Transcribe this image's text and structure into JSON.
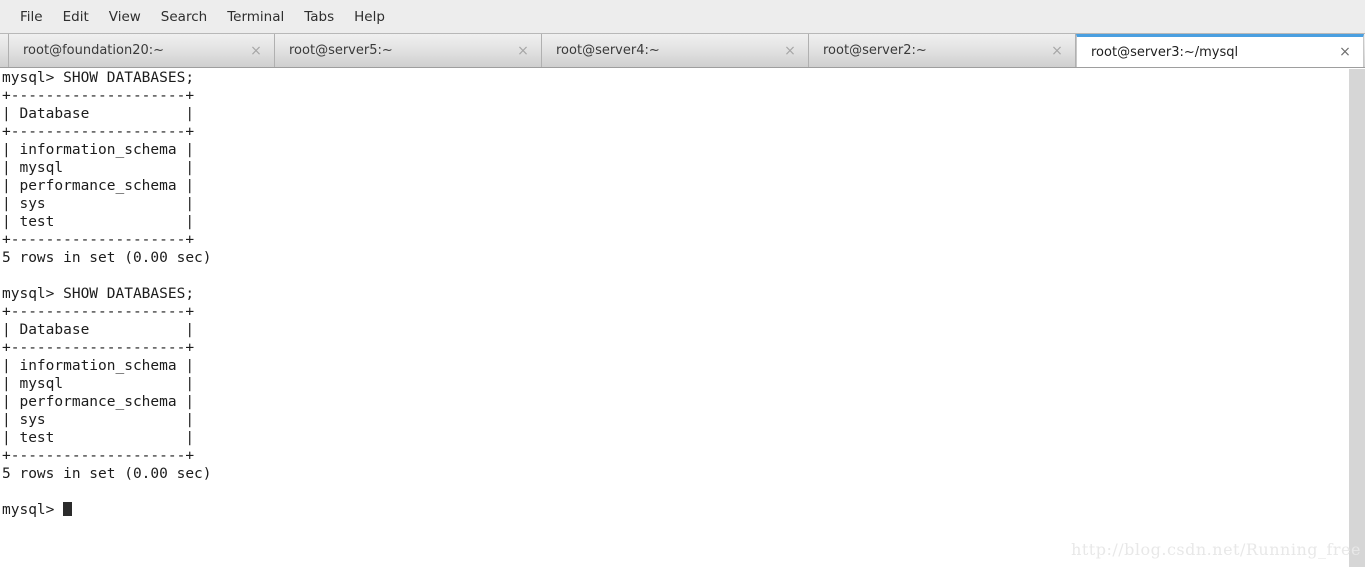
{
  "menu": {
    "items": [
      {
        "label": "File",
        "name": "menu-file"
      },
      {
        "label": "Edit",
        "name": "menu-edit"
      },
      {
        "label": "View",
        "name": "menu-view"
      },
      {
        "label": "Search",
        "name": "menu-search"
      },
      {
        "label": "Terminal",
        "name": "menu-terminal"
      },
      {
        "label": "Tabs",
        "name": "menu-tabs"
      },
      {
        "label": "Help",
        "name": "menu-help"
      }
    ]
  },
  "tabs": {
    "close_glyph": "×",
    "items": [
      {
        "label": "root@foundation20:~",
        "active": false
      },
      {
        "label": "root@server5:~",
        "active": false
      },
      {
        "label": "root@server4:~",
        "active": false
      },
      {
        "label": "root@server2:~",
        "active": false
      },
      {
        "label": "root@server3:~/mysql",
        "active": true
      }
    ]
  },
  "terminal": {
    "prompt": "mysql> ",
    "content": "mysql> SHOW DATABASES;\n+--------------------+\n| Database           |\n+--------------------+\n| information_schema |\n| mysql              |\n| performance_schema |\n| sys                |\n| test               |\n+--------------------+\n5 rows in set (0.00 sec)\n\nmysql> SHOW DATABASES;\n+--------------------+\n| Database           |\n+--------------------+\n| information_schema |\n| mysql              |\n| performance_schema |\n| sys                |\n| test               |\n+--------------------+\n5 rows in set (0.00 sec)\n\n",
    "last_prompt": "mysql> ",
    "commands": [
      "SHOW DATABASES;",
      "SHOW DATABASES;"
    ],
    "result_table": {
      "columns": [
        "Database"
      ],
      "rows": [
        [
          "information_schema"
        ],
        [
          "mysql"
        ],
        [
          "performance_schema"
        ],
        [
          "sys"
        ],
        [
          "test"
        ]
      ],
      "footer": "5 rows in set (0.00 sec)"
    }
  },
  "watermark": {
    "text": "http://blog.csdn.net/Running_free"
  },
  "colors": {
    "menubar_bg": "#ededed",
    "tabbar_bg": "#e3e3e3",
    "active_tab_accent": "#4a9fe0",
    "terminal_bg": "#ffffff",
    "terminal_fg": "#1c1c1c",
    "scrollbar": "#d6d6d6",
    "watermark": "#e8e8e8"
  }
}
